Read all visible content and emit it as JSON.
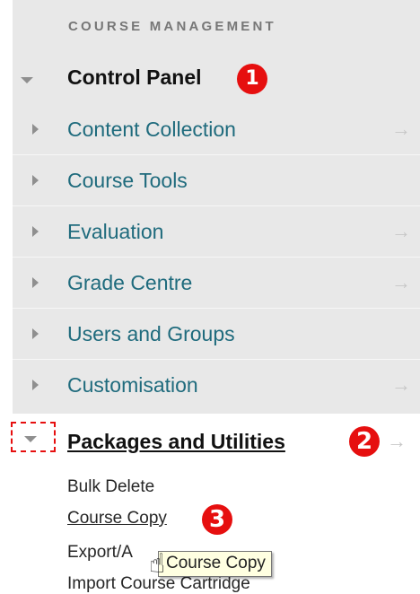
{
  "section_header": "COURSE MANAGEMENT",
  "control_panel": {
    "label": "Control Panel",
    "badge": "❶",
    "items": [
      {
        "label": "Content Collection",
        "arrow": "→"
      },
      {
        "label": "Course Tools",
        "arrow": ""
      },
      {
        "label": "Evaluation",
        "arrow": "→"
      },
      {
        "label": "Grade Centre",
        "arrow": "→"
      },
      {
        "label": "Users and Groups",
        "arrow": ""
      },
      {
        "label": "Customisation",
        "arrow": "→"
      }
    ]
  },
  "packages_and_utilities": {
    "label": "Packages and Utilities",
    "badge": "2",
    "arrow": "→",
    "items": [
      {
        "label": "Bulk Delete"
      },
      {
        "label": "Course Copy"
      },
      {
        "label": "Export/A"
      },
      {
        "label": "Import Course Cartridge"
      }
    ]
  },
  "annotation_badge_3": "3",
  "tooltip": "Course Copy",
  "colors": {
    "panel_bg": "#e8e8e8",
    "link_teal": "#1f6b7d",
    "badge_red": "#e60f0f"
  },
  "icons": [
    "expand-triangle-down-icon",
    "collapse-triangle-right-icon",
    "go-arrow-icon",
    "hand-cursor-icon"
  ]
}
